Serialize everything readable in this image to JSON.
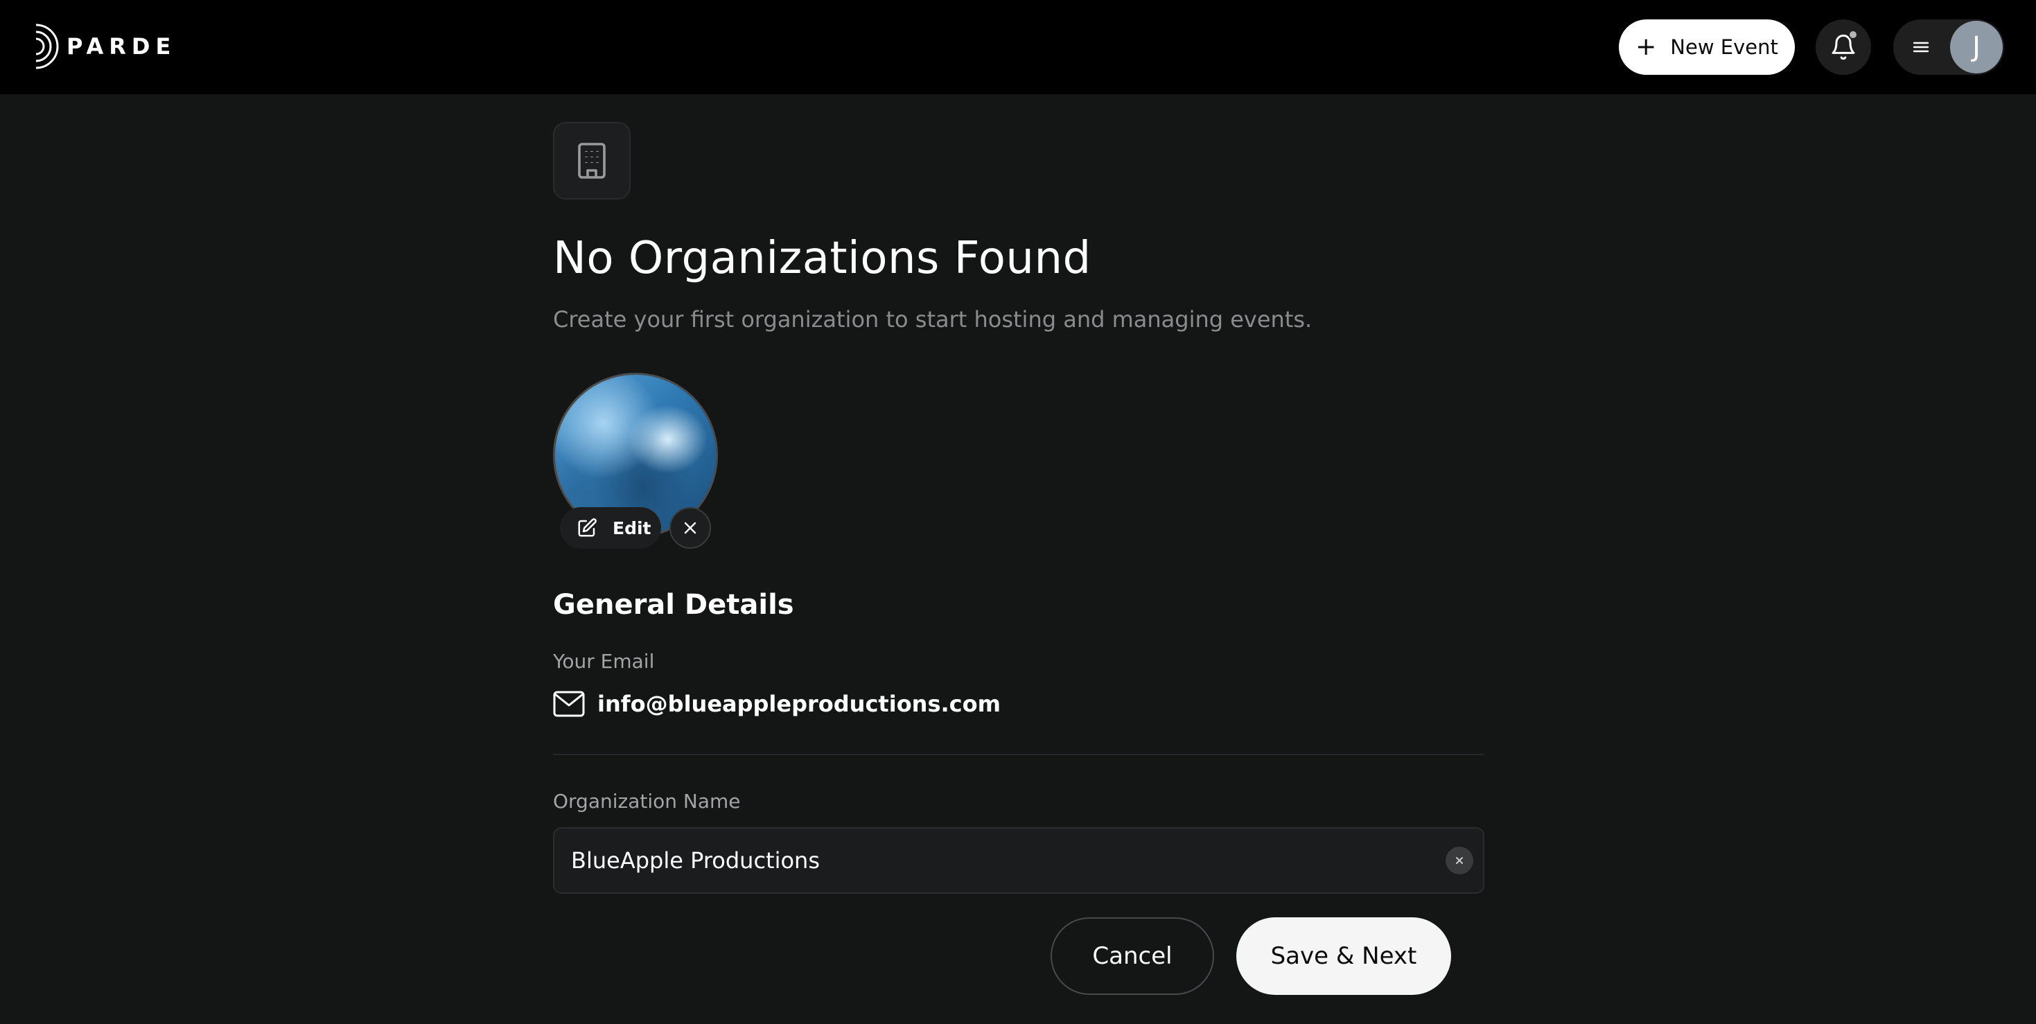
{
  "header": {
    "brand": "PARDE",
    "new_event_label": "New Event",
    "has_notification": true,
    "user_initial": "J"
  },
  "main": {
    "title": "No Organizations Found",
    "subtitle": "Create your first organization to start hosting and managing events.",
    "photo": {
      "edit_label": "Edit"
    },
    "general_details": {
      "title": "General Details",
      "email_label": "Your Email",
      "email_value": "info@blueappleproductions.com"
    },
    "organization_name": {
      "label": "Organization Name",
      "value": "BlueApple Productions"
    },
    "actions": {
      "cancel_label": "Cancel",
      "save_label": "Save & Next"
    }
  },
  "colors": {
    "background": "#141515",
    "topbar": "#000000",
    "primary_button": "#ffffff",
    "muted_text": "#8b8c8d"
  },
  "icons": [
    "parde-logo-icon",
    "plus-icon",
    "bell-icon",
    "menu-icon",
    "building-icon",
    "edit-icon",
    "close-icon",
    "mail-icon",
    "clear-icon"
  ]
}
